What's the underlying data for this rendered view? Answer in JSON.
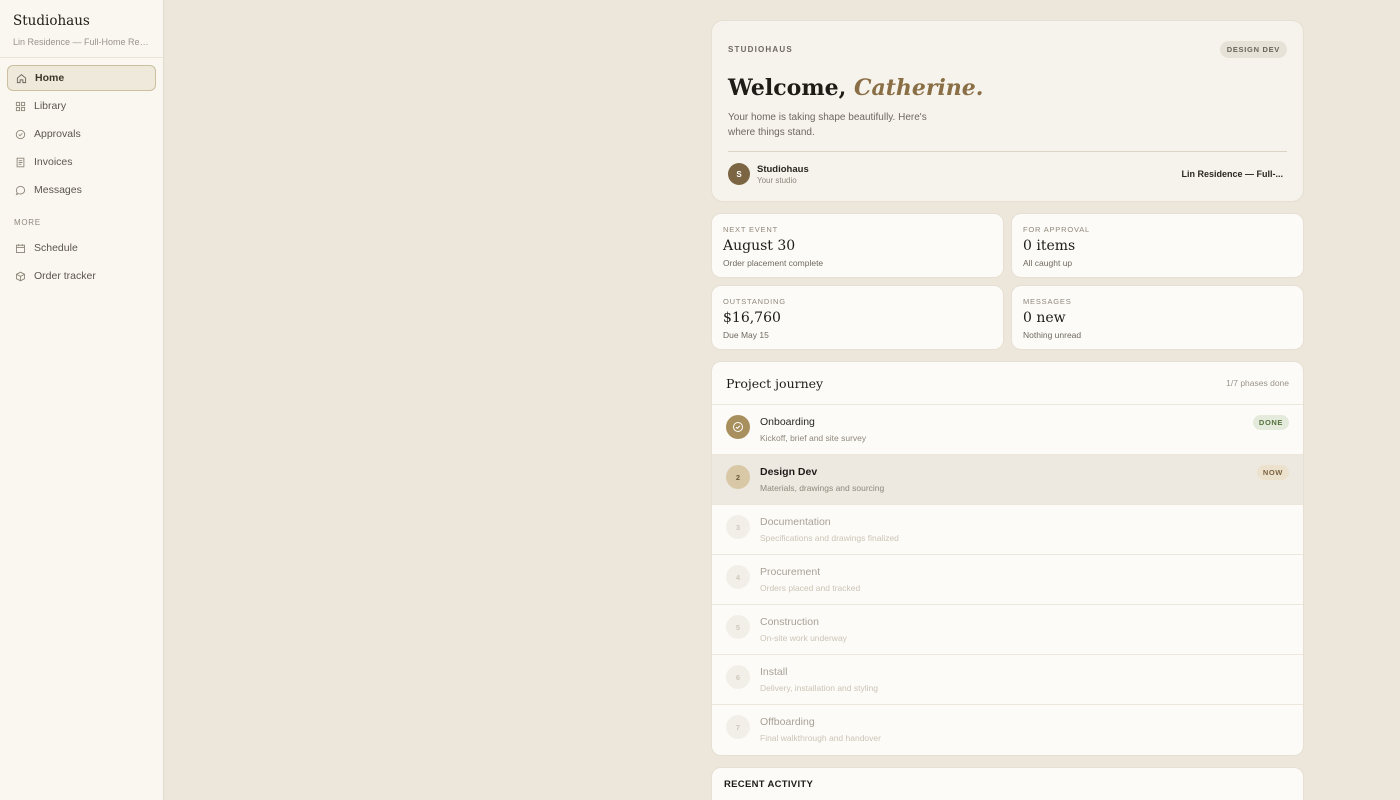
{
  "sidebar": {
    "brand": "Studiohaus",
    "project": "Lin Residence — Full-Home Renov...",
    "items": [
      {
        "label": "Home",
        "icon": "home-icon"
      },
      {
        "label": "Library",
        "icon": "grid-icon"
      },
      {
        "label": "Approvals",
        "icon": "check-circle-icon"
      },
      {
        "label": "Invoices",
        "icon": "document-icon"
      },
      {
        "label": "Messages",
        "icon": "chat-bubble-icon"
      }
    ],
    "more_label": "MORE",
    "more_items": [
      {
        "label": "Schedule",
        "icon": "calendar-icon"
      },
      {
        "label": "Order tracker",
        "icon": "package-icon"
      }
    ]
  },
  "hero": {
    "eyebrow": "STUDIOHAUS",
    "stage_pill": "DESIGN DEV",
    "welcome_prefix": "Welcome, ",
    "welcome_name": "Catherine.",
    "description": "Your home is taking shape beautifully. Here's where things stand.",
    "studio_initial": "S",
    "studio_name": "Studiohaus",
    "studio_role": "Your studio",
    "project_name": "Lin Residence — Full-..."
  },
  "stats": {
    "next_event": {
      "label": "NEXT EVENT",
      "value": "August 30",
      "sub": "Order placement complete"
    },
    "for_approval": {
      "label": "FOR APPROVAL",
      "value": "0 items",
      "sub": "All caught up"
    },
    "outstanding": {
      "label": "OUTSTANDING",
      "value": "$16,760",
      "sub": "Due May 15"
    },
    "messages": {
      "label": "MESSAGES",
      "value": "0 new",
      "sub": "Nothing unread"
    }
  },
  "journey": {
    "title": "Project journey",
    "count": "1/7 phases done",
    "phases": [
      {
        "num": "",
        "title": "Onboarding",
        "sub": "Kickoff, brief and site survey",
        "badge": "DONE"
      },
      {
        "num": "2",
        "title": "Design Dev",
        "sub": "Materials, drawings and sourcing",
        "badge": "NOW"
      },
      {
        "num": "3",
        "title": "Documentation",
        "sub": "Specifications and drawings finalized"
      },
      {
        "num": "4",
        "title": "Procurement",
        "sub": "Orders placed and tracked"
      },
      {
        "num": "5",
        "title": "Construction",
        "sub": "On-site work underway"
      },
      {
        "num": "6",
        "title": "Install",
        "sub": "Delivery, installation and styling"
      },
      {
        "num": "7",
        "title": "Offboarding",
        "sub": "Final walkthrough and handover"
      }
    ]
  },
  "recent": {
    "title": "RECENT ACTIVITY"
  },
  "colors": {
    "background": "#ede6da",
    "accent": "#8a6f46",
    "done_badge": "#55733f"
  }
}
